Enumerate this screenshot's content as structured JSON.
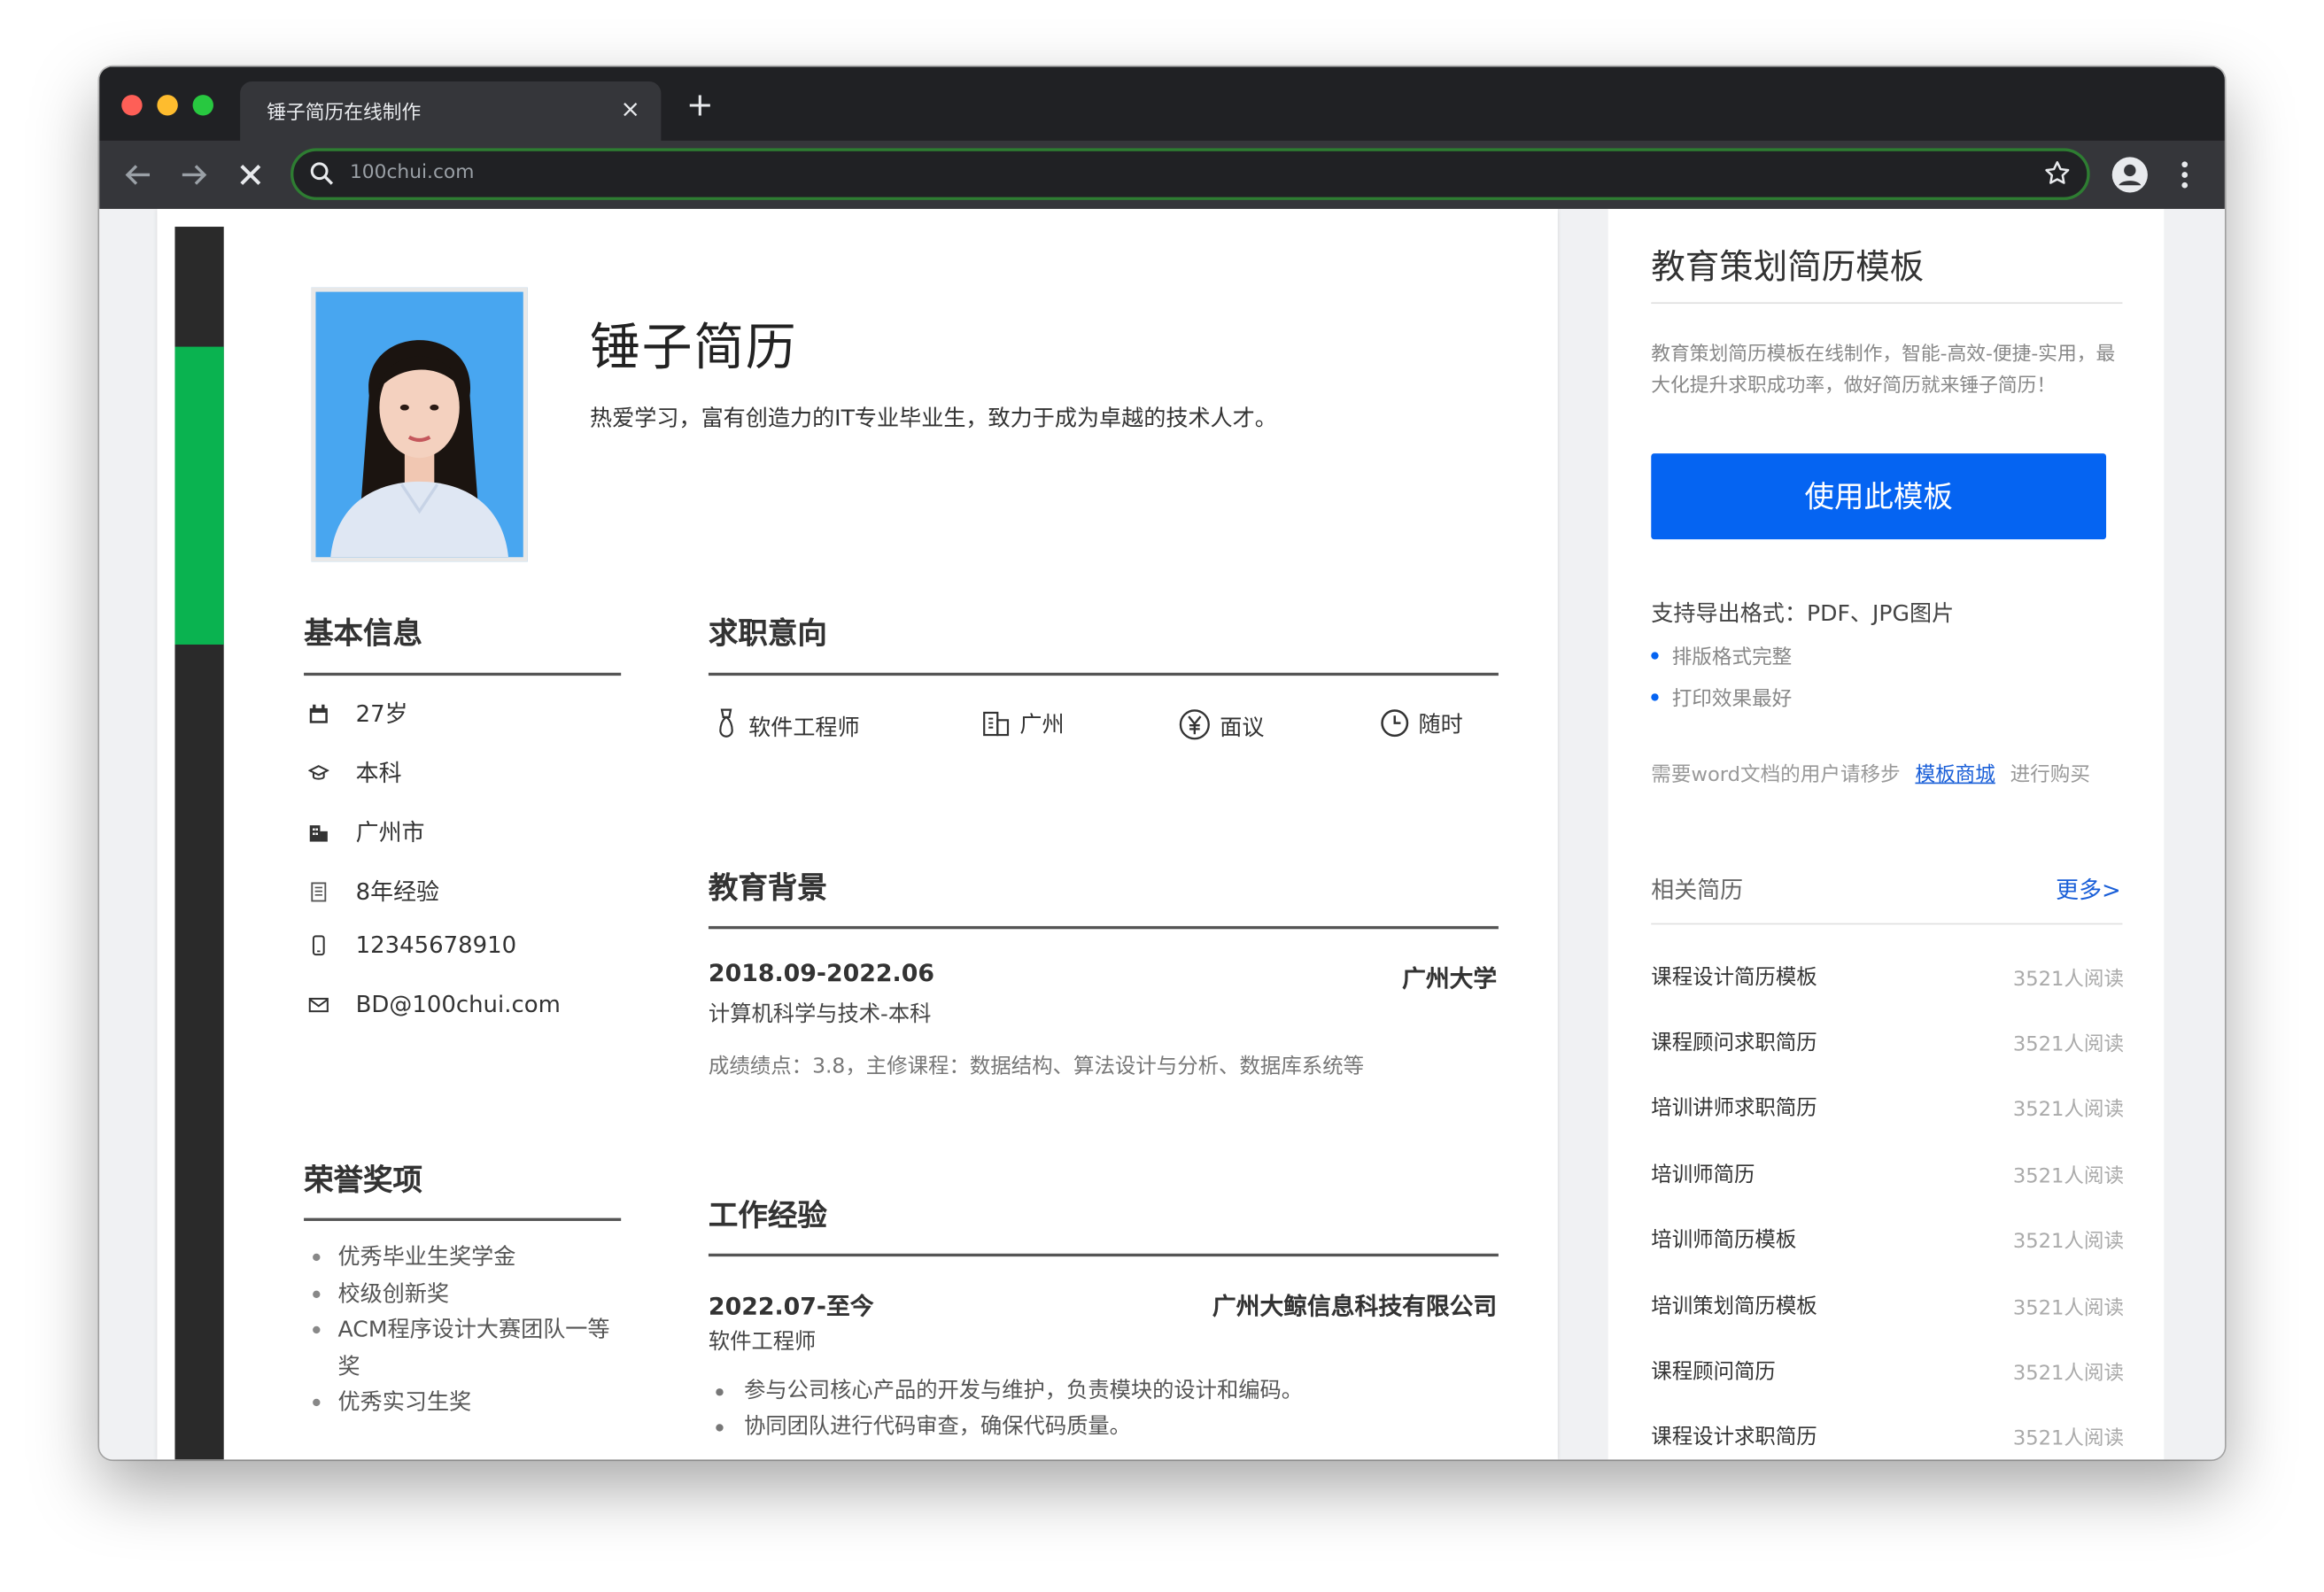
{
  "browser": {
    "tab_title": "锤子简历在线制作",
    "tab_close": "×",
    "new_tab": "+",
    "url": "100chui.com"
  },
  "resume": {
    "name": "锤子简历",
    "slogan": "热爱学习，富有创造力的IT专业毕业生，致力于成为卓越的技术人才。",
    "basic_title": "基本信息",
    "basic_info": [
      {
        "icon": "calendar-icon",
        "text": "27岁"
      },
      {
        "icon": "graduation-cap-icon",
        "text": "本科"
      },
      {
        "icon": "building-icon",
        "text": "广州市"
      },
      {
        "icon": "document-icon",
        "text": "8年经验"
      },
      {
        "icon": "phone-icon",
        "text": "12345678910"
      },
      {
        "icon": "mail-icon",
        "text": "BD@100chui.com"
      }
    ],
    "intent_title": "求职意向",
    "intent": [
      {
        "icon": "medal-icon",
        "text": "软件工程师"
      },
      {
        "icon": "city-icon",
        "text": "广州"
      },
      {
        "icon": "yen-icon",
        "text": "面议"
      },
      {
        "icon": "clock-icon",
        "text": "随时"
      }
    ],
    "education_title": "教育背景",
    "education": {
      "date": "2018.09-2022.06",
      "school": "广州大学",
      "major": "计算机科学与技术-本科",
      "desc": "成绩绩点：3.8，主修课程：数据结构、算法设计与分析、数据库系统等"
    },
    "honors_title": "荣誉奖项",
    "honors": [
      "优秀毕业生奖学金",
      "校级创新奖",
      "ACM程序设计大赛团队一等奖",
      "优秀实习生奖"
    ],
    "work_title": "工作经验",
    "work": {
      "date": "2022.07-至今",
      "company": "广州大鲸信息科技有限公司",
      "role": "软件工程师",
      "items": [
        "参与公司核心产品的开发与维护，负责模块的设计和编码。",
        "协同团队进行代码审查，确保代码质量。",
        "…"
      ]
    }
  },
  "sidebar": {
    "title": "教育策划简历模板",
    "desc": "教育策划简历模板在线制作，智能-高效-便捷-实用，最大化提升求职成功率，做好简历就来锤子简历！",
    "use_button": "使用此模板",
    "formats": "支持导出格式：PDF、JPG图片",
    "features": [
      "排版格式完整",
      "打印效果最好"
    ],
    "word_note_prefix": "需要word文档的用户请移步",
    "word_note_link": "模板商城",
    "word_note_suffix": "进行购买",
    "related_title": "相关简历",
    "more": "更多>",
    "related": [
      {
        "title": "课程设计简历模板",
        "reads": "3521人阅读"
      },
      {
        "title": "课程顾问求职简历",
        "reads": "3521人阅读"
      },
      {
        "title": "培训讲师求职简历",
        "reads": "3521人阅读"
      },
      {
        "title": "培训师简历",
        "reads": "3521人阅读"
      },
      {
        "title": "培训师简历模板",
        "reads": "3521人阅读"
      },
      {
        "title": "培训策划简历模板",
        "reads": "3521人阅读"
      },
      {
        "title": "课程顾问简历",
        "reads": "3521人阅读"
      },
      {
        "title": "课程设计求职简历",
        "reads": "3521人阅读"
      }
    ]
  }
}
